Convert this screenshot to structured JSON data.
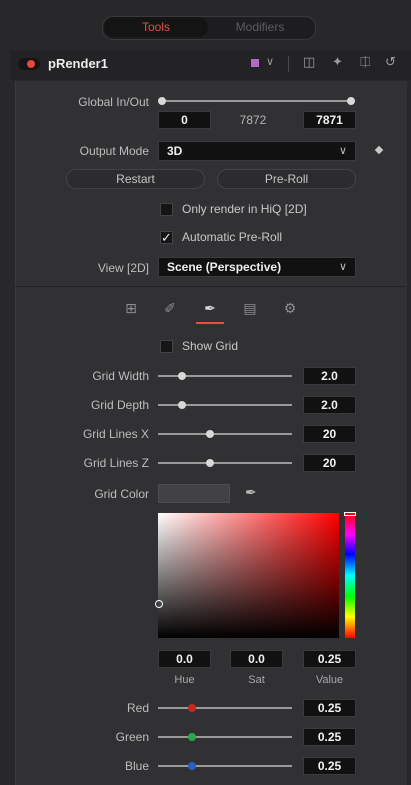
{
  "tabs": {
    "tools": "Tools",
    "modifiers": "Modifiers"
  },
  "header": {
    "tool_name": "pRender1",
    "color_swatch": "#b06bc8"
  },
  "global_in_out": {
    "label": "Global In/Out",
    "in_value": "0",
    "center_value": "7872",
    "out_value": "7871"
  },
  "output_mode": {
    "label": "Output Mode",
    "value": "3D"
  },
  "buttons": {
    "restart": "Restart",
    "preroll": "Pre-Roll"
  },
  "checkboxes": {
    "hiq": {
      "label": "Only render in HiQ [2D]",
      "checked": false
    },
    "auto_preroll": {
      "label": "Automatic Pre-Roll",
      "checked": true
    },
    "show_grid": {
      "label": "Show Grid",
      "checked": false
    }
  },
  "view2d": {
    "label": "View [2D]",
    "value": "Scene (Perspective)"
  },
  "grid": {
    "width": {
      "label": "Grid Width",
      "value": "2.0",
      "level": 0.18
    },
    "depth": {
      "label": "Grid Depth",
      "value": "2.0",
      "level": 0.18
    },
    "lines_x": {
      "label": "Grid Lines X",
      "value": "20",
      "level": 0.39
    },
    "lines_z": {
      "label": "Grid Lines Z",
      "value": "20",
      "level": 0.39
    },
    "color_label": "Grid Color"
  },
  "hsv": {
    "hue": {
      "label": "Hue",
      "value": "0.0"
    },
    "sat": {
      "label": "Sat",
      "value": "0.0"
    },
    "val": {
      "label": "Value",
      "value": "0.25"
    }
  },
  "rgb": {
    "red": {
      "label": "Red",
      "value": "0.25",
      "level": 0.25,
      "color": "#c8261e"
    },
    "green": {
      "label": "Green",
      "value": "0.25",
      "level": 0.25,
      "color": "#2aa84a"
    },
    "blue": {
      "label": "Blue",
      "value": "0.25",
      "level": 0.25,
      "color": "#2a5fc8"
    }
  },
  "accent_color": "#e05444"
}
